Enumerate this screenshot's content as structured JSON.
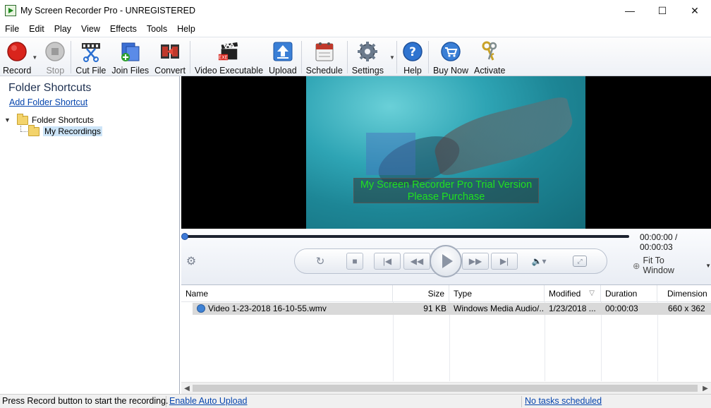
{
  "window": {
    "title": "My Screen Recorder Pro - UNREGISTERED",
    "minimize": "—",
    "maximize": "☐",
    "close": "✕"
  },
  "menu": [
    "File",
    "Edit",
    "Play",
    "View",
    "Effects",
    "Tools",
    "Help"
  ],
  "toolbar": {
    "record": "Record",
    "stop": "Stop",
    "cut_file": "Cut File",
    "join_files": "Join Files",
    "convert": "Convert",
    "video_executable": "Video Executable",
    "upload": "Upload",
    "schedule": "Schedule",
    "settings": "Settings",
    "help": "Help",
    "buy_now": "Buy Now",
    "activate": "Activate"
  },
  "sidebar": {
    "title": "Folder Shortcuts",
    "add_link": "Add Folder Shortcut",
    "tree": {
      "root": "Folder Shortcuts",
      "child": "My Recordings"
    }
  },
  "video": {
    "watermark_line1": "My Screen Recorder Pro Trial Version",
    "watermark_line2": "Please Purchase"
  },
  "player": {
    "time": "00:00:00 / 00:00:03",
    "progress": 0,
    "fit_label": "Fit To Window"
  },
  "filelist": {
    "columns": {
      "name": "Name",
      "size": "Size",
      "type": "Type",
      "modified": "Modified",
      "duration": "Duration",
      "dimension": "Dimension"
    },
    "rows": [
      {
        "name": "Video 1-23-2018 16-10-55.wmv",
        "size": "91 KB",
        "type": "Windows Media Audio/...",
        "modified": "1/23/2018 ...",
        "duration": "00:00:03",
        "dimension": "660 x 362"
      }
    ]
  },
  "status": {
    "message": "Press Record button to start the recording.",
    "auto_upload": "Enable Auto Upload",
    "tasks": "No tasks scheduled"
  },
  "colors": {
    "accent_link": "#0645ad",
    "record_red": "#d9241c",
    "watermark_green": "#20e020",
    "selection_blue": "#cce4f7"
  }
}
